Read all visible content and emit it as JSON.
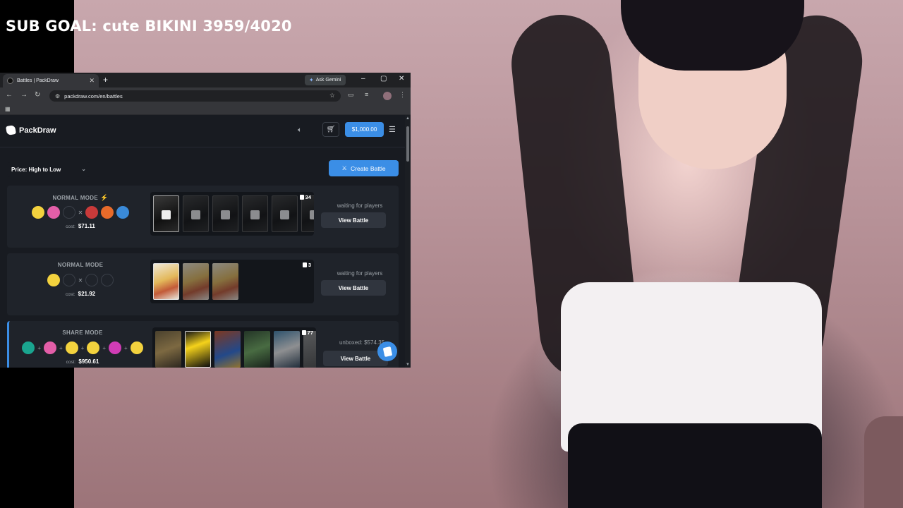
{
  "overlay": {
    "sub_goal": "SUB GOAL: cute BIKINI 3959/4020"
  },
  "browser": {
    "tab_title": "Battles | PackDraw",
    "ask_gemini": "Ask Gemini",
    "url": "packdraw.com/en/battles"
  },
  "site": {
    "logo": "PackDraw",
    "balance": "$1,000.00",
    "sort_label": "Price: High to Low",
    "create_battle": "Create Battle",
    "fab_icon": "cards-icon"
  },
  "battles": [
    {
      "mode": "NORMAL MODE",
      "cost_label": "cost:",
      "cost": "$71.11",
      "pack_count": "34",
      "status": "waiting for players",
      "view": "View Battle"
    },
    {
      "mode": "NORMAL MODE",
      "cost_label": "cost:",
      "cost": "$21.92",
      "pack_count": "3",
      "status": "waiting for players",
      "view": "View Battle"
    },
    {
      "mode": "SHARE MODE",
      "cost_label": "cost:",
      "cost": "$950.61",
      "pack_count": "77",
      "status": "unboxed: $574.35",
      "view": "View Battle"
    }
  ],
  "colors": {
    "accent": "#3b8ee6",
    "bg": "#181b21",
    "card": "#1f232a"
  }
}
